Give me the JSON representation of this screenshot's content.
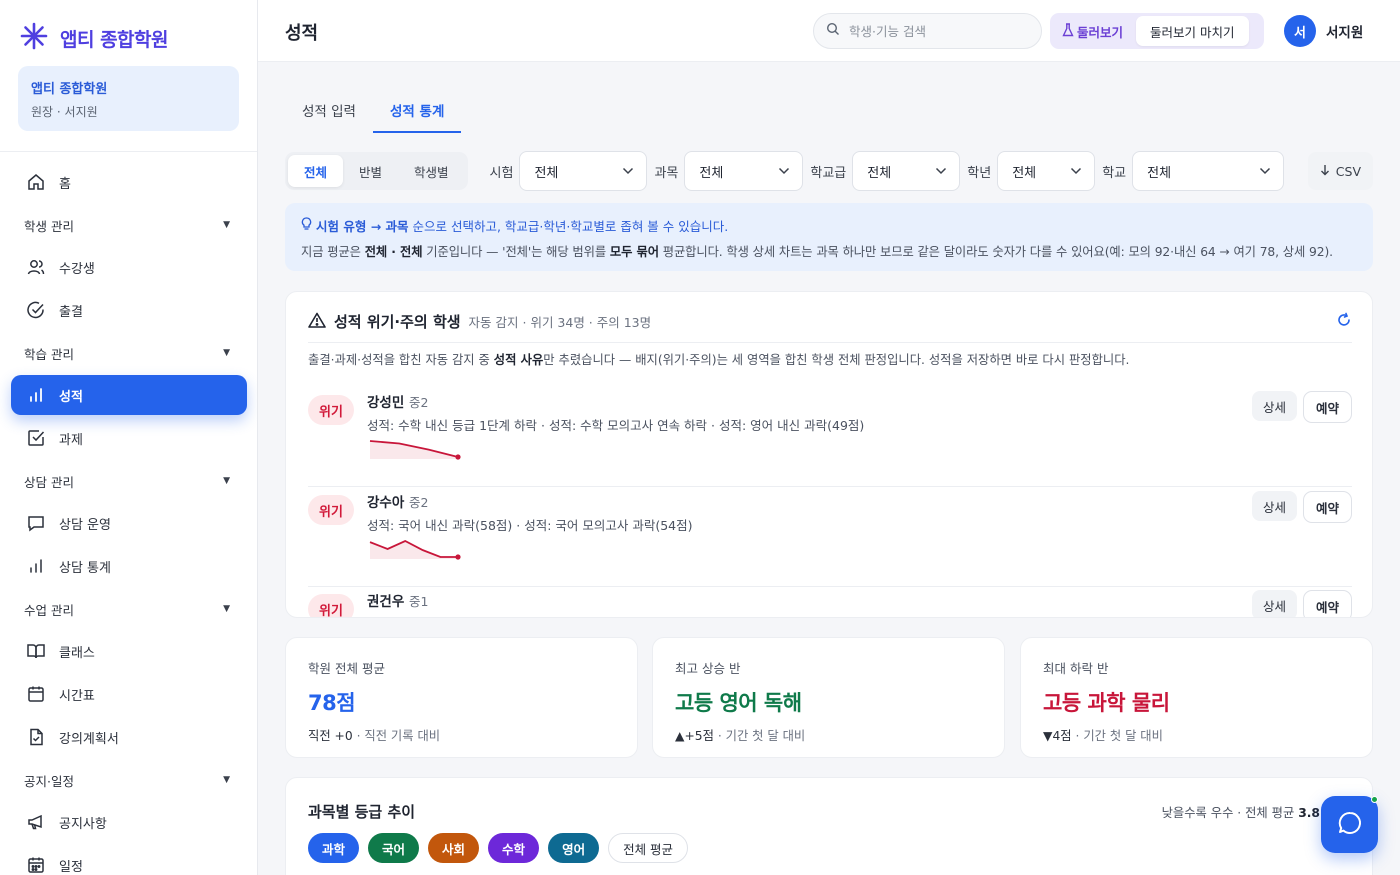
{
  "brand": {
    "name": "앱티 종합학원"
  },
  "org": {
    "name": "앱티 종합학원",
    "role": "원장 · 서지원"
  },
  "nav": {
    "home": "홈",
    "sec_students": "학생 관리",
    "students": "수강생",
    "attendance": "출결",
    "sec_learning": "학습 관리",
    "grades": "성적",
    "homework": "과제",
    "sec_counsel": "상담 관리",
    "counsel_ops": "상담 운영",
    "counsel_stats": "상담 통계",
    "sec_class": "수업 관리",
    "classes": "클래스",
    "timetable": "시간표",
    "syllabus": "강의계획서",
    "sec_notice": "공지·일정",
    "notices": "공지사항",
    "schedule": "일정"
  },
  "header": {
    "title": "성적",
    "search_placeholder": "학생·기능 검색",
    "browse": "둘러보기",
    "browse_end": "둘러보기 마치기",
    "avatar_initial": "서",
    "user_name": "서지원"
  },
  "tabs": [
    "성적 입력",
    "성적 통계"
  ],
  "filters": {
    "segments": [
      "전체",
      "반별",
      "학생별"
    ],
    "exam_label": "시험",
    "exam_value": "전체",
    "subject_label": "과목",
    "subject_value": "전체",
    "level_label": "학교급",
    "level_value": "전체",
    "grade_label": "학년",
    "grade_value": "전체",
    "school_label": "학교",
    "school_value": "전체",
    "csv": "CSV"
  },
  "info": {
    "l1_a": "시험 유형 → 과목",
    "l1_b": " 순으로 선택하고, 학교급·학년·학교별로 좁혀 볼 수 있습니다.",
    "l2_a": "지금 평균은 ",
    "l2_b": "전체 · 전체",
    "l2_c": " 기준입니다 — '전체'는 해당 범위를 ",
    "l2_d": "모두 묶어",
    "l2_e": " 평균합니다. 학생 상세 차트는 과목 하나만 보므로 같은 달이라도 숫자가 다를 수 있어요(예: 모의 92·내신 64 → 여기 78, 상세 92)."
  },
  "risk": {
    "title": "성적 위기·주의 학생",
    "subtitle": "자동 감지 · 위기 34명 · 주의 13명",
    "desc_a": "출결·과제·성적을 합친 자동 감지 중 ",
    "desc_b": "성적 사유",
    "desc_c": "만 추렸습니다 — 배지(위기·주의)는 세 영역을 합친 학생 전체 판정입니다. 성적을 저장하면 바로 다시 판정합니다.",
    "detail_label": "상세",
    "book_label": "예약",
    "students": [
      {
        "badge": "위기",
        "name": "강성민",
        "grade": "중2",
        "reason": "성적: 수학 내신 등급 1단계 하락 · 성적: 수학 모의고사 연속 하락 · 성적: 영어 내신 과락(49점)",
        "trend": [
          92,
          88,
          78,
          66
        ]
      },
      {
        "badge": "위기",
        "name": "강수아",
        "grade": "중2",
        "reason": "성적: 국어 내신 과락(58점) · 성적: 국어 모의고사 과락(54점)",
        "trend": [
          80,
          68,
          82,
          66,
          54,
          54
        ]
      },
      {
        "badge": "위기",
        "name": "권건우",
        "grade": "중1",
        "reason": "",
        "trend": []
      }
    ]
  },
  "stats": [
    {
      "label": "학원 전체 평균",
      "value": "78점",
      "color": "#2563eb",
      "note_a": "직전 +0",
      "note_b": " · 직전 기록 대비"
    },
    {
      "label": "최고 상승 반",
      "value": "고등 영어 독해",
      "color": "#0f7a4a",
      "note_a": "▲+5점",
      "note_b": " · 기간 첫 달 대비"
    },
    {
      "label": "최대 하락 반",
      "value": "고등 과학 물리",
      "color": "#c8163a",
      "note_a": "▼4점",
      "note_b": " · 기간 첫 달 대비"
    }
  ],
  "trend": {
    "title": "과목별 등급 추이",
    "note_a": "낮을수록 우수 · 전체 평균 ",
    "note_b": "3.8",
    "chips": [
      {
        "label": "과학",
        "color": "#2563eb"
      },
      {
        "label": "국어",
        "color": "#0f7a4a"
      },
      {
        "label": "사회",
        "color": "#c2570c"
      },
      {
        "label": "수학",
        "color": "#6d28d9"
      },
      {
        "label": "영어",
        "color": "#0e6a92"
      },
      {
        "label": "전체 평균",
        "color": ""
      }
    ]
  },
  "colors": {
    "primary": "#2563eb",
    "danger": "#d11a3a",
    "brand": "#4f3fe0"
  }
}
